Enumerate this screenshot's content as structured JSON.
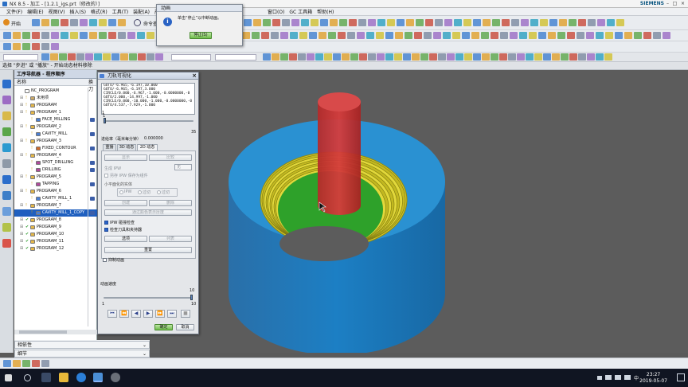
{
  "window": {
    "title": "NX 8.5 - 加工 - [1.2.1_igs.prt（修改的）]",
    "brand": "SIEMENS",
    "win_controls": [
      "–",
      "□",
      "×"
    ]
  },
  "menu": [
    "文件(F)",
    "编辑(E)",
    "视图(V)",
    "插入(S)",
    "格式(R)",
    "工具(T)",
    "装配(A)",
    "产品"
  ],
  "menu_right": [
    "窗口(O)",
    "GC 工具箱",
    "帮助(H)"
  ],
  "toolbar": {
    "start_label": "开始",
    "command_finder_label": "命令查"
  },
  "cue_line": "选择 \"步进\" 或 \"播放\" - 开始动态材料移除",
  "navigator": {
    "title": "工序导航器 - 程序顺序",
    "col_name": "名称",
    "col_change": "换刀",
    "rows": [
      {
        "level": 0,
        "label": "NC_PROGRAM",
        "color": "#ffffff",
        "check": false
      },
      {
        "level": 1,
        "label": "未用项",
        "color": "#c9a868",
        "check": false
      },
      {
        "level": 1,
        "label": "PROGRAM",
        "color": "#e2b64a",
        "check": false
      },
      {
        "level": 1,
        "label": "PROGRAM_1",
        "color": "#e2b64a",
        "check": false
      },
      {
        "level": 2,
        "label": "FACE_MILLING",
        "color": "#4a7fd4",
        "check": false
      },
      {
        "level": 1,
        "label": "PROGRAM_2",
        "color": "#e2b64a",
        "check": false
      },
      {
        "level": 2,
        "label": "CAVITY_MILL",
        "color": "#4a7fd4",
        "check": false
      },
      {
        "level": 1,
        "label": "PROGRAM_3",
        "color": "#e2b64a",
        "check": false
      },
      {
        "level": 2,
        "label": "FIXED_CONTOUR",
        "color": "#d06a2a",
        "check": false
      },
      {
        "level": 1,
        "label": "PROGRAM_4",
        "color": "#e2b64a",
        "check": false
      },
      {
        "level": 2,
        "label": "SPOT_DRILLING",
        "color": "#b04a9a",
        "check": false
      },
      {
        "level": 2,
        "label": "DRILLING",
        "color": "#b04a9a",
        "check": false
      },
      {
        "level": 1,
        "label": "PROGRAM_5",
        "color": "#e2b64a",
        "check": false
      },
      {
        "level": 2,
        "label": "TAPPING",
        "color": "#b04a9a",
        "check": false
      },
      {
        "level": 1,
        "label": "PROGRAM_6",
        "color": "#e2b64a",
        "check": false
      },
      {
        "level": 2,
        "label": "CAVITY_MILL_1",
        "color": "#4a7fd4",
        "check": false
      },
      {
        "level": 1,
        "label": "PROGRAM_7",
        "color": "#e2b64a",
        "check": false
      },
      {
        "level": 2,
        "label": "CAVITY_MILL_1_COPY",
        "color": "#4a7fd4",
        "check": false,
        "selected": true
      },
      {
        "level": 1,
        "label": "PROGRAM_8",
        "color": "#e2b64a",
        "check": true
      },
      {
        "level": 1,
        "label": "PROGRAM_9",
        "color": "#e2b64a",
        "check": true
      },
      {
        "level": 1,
        "label": "PROGRAM_10",
        "color": "#e2b64a",
        "check": true
      },
      {
        "level": 1,
        "label": "PROGRAM_11",
        "color": "#e2b64a",
        "check": true
      },
      {
        "level": 1,
        "label": "PROGRAM_12",
        "color": "#e2b64a",
        "check": true
      }
    ],
    "panel_dependencies": "相依性",
    "panel_details": "细节"
  },
  "animation_dialog": {
    "title": "动画",
    "message": "单击“停止”以中断动画。",
    "stop_button": "停止(S)"
  },
  "visualize_dialog": {
    "title": "刀轨可视化",
    "toolpath_lines": [
      "GOTO/-6.965,-6.197,10.000",
      "GOTO/-6.965,-6.197,3.000",
      "CIRCLE/0.000,-6.967,-1.000,-0.0000000,-0",
      "GOTO/2.000,-14.997,-1.000",
      "CIRCLE/0.000,-10.000,-1.000,-0.0000000,-0",
      "GOTO/4.537,-7.929,-1.000"
    ],
    "list_scroll_label": "1",
    "slider_min": "1",
    "slider_max": "35",
    "feed_label": "进给率（毫米每分钟）",
    "feed_value": "0.000000",
    "tabs": [
      "重播",
      "3D 动态",
      "2D 动态"
    ],
    "active_tab": 2,
    "btn_show": "显示",
    "btn_compare": "比较",
    "ipw_label": "生成 IPW",
    "ipw_value": "无",
    "save_ipw_component": "另存 IPW 保存为组件",
    "facet_label": "小平面化的实体",
    "radio_ipw": "IPW",
    "radio_excess": "过切",
    "radio_gouge": "过切",
    "btn_create": "创建",
    "btn_delete": "删除",
    "btn_analyze": "通过颜色表示厚度",
    "check_ipw_collision": "IPW 碰撞检查",
    "check_tool_holder": "检查刀具和夹持器",
    "btn_options": "选项",
    "btn_list": "列表",
    "btn_reset": "重置",
    "check_suppress_anim": "抑制动画",
    "speed_label": "动画速度",
    "speed_min": "1",
    "speed_max": "10",
    "speed_top_value": "10",
    "speed_fraction": 1.0,
    "playback": [
      "⏮",
      "⏪",
      "◀",
      "▶",
      "⏩",
      "⏭",
      "■"
    ],
    "ok_button": "确定",
    "cancel_button": "取消"
  },
  "viewport": {
    "workpiece_color": "#2a8fd0",
    "inner_color": "#d8d020",
    "bottom_color": "#2aa02a",
    "tool_color": "#c43434"
  },
  "taskbar": {
    "time": "23:27",
    "date": "2019-05-07"
  }
}
